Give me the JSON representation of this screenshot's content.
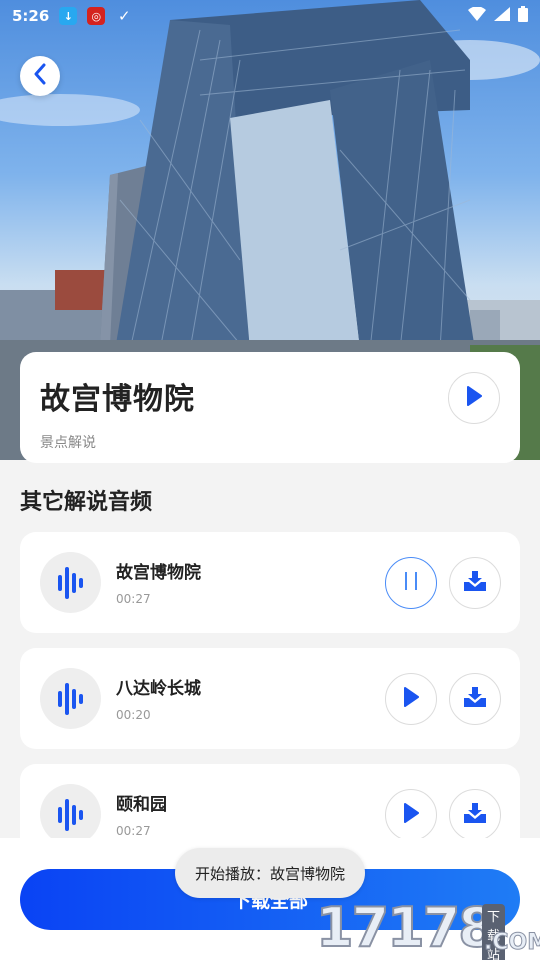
{
  "status_bar": {
    "time": "5:26"
  },
  "hero": {
    "image_description_icon": "building-photo"
  },
  "title_card": {
    "title": "故宫博物院",
    "subtitle": "景点解说"
  },
  "section": {
    "title": "其它解说音频"
  },
  "items": [
    {
      "name": "故宫博物院",
      "duration": "00:27",
      "state": "playing"
    },
    {
      "name": "八达岭长城",
      "duration": "00:20",
      "state": "paused"
    },
    {
      "name": "颐和园",
      "duration": "00:27",
      "state": "paused"
    }
  ],
  "bottom": {
    "download_all_label": "下载全部"
  },
  "toast": {
    "text": "开始播放：故宫博物院"
  },
  "watermark": {
    "number": "17178",
    "tag": "下载站",
    "domain": ".COM"
  },
  "colors": {
    "accent": "#1a55f0",
    "active_border": "#4a8cf7"
  }
}
